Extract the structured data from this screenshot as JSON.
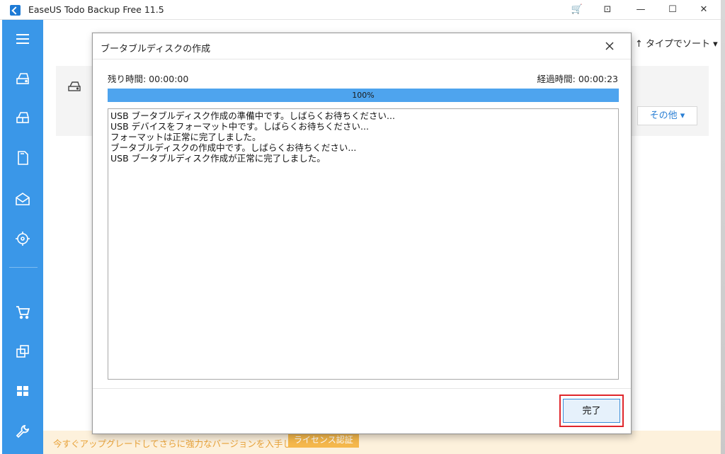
{
  "window": {
    "title": "EaseUS Todo Backup Free 11.5",
    "cart_glyph": "🛒",
    "menu_glyph": "⊡",
    "minimize_glyph": "—",
    "maximize_glyph": "☐",
    "close_glyph": "✕"
  },
  "background": {
    "sort_label": "↑ タイプでソート ▾",
    "other_label": "その他 ▾",
    "license_text": "今すぐアップグレードしてさらに強力なバージョンを入手しましょう。",
    "license_button": "ライセンス認証"
  },
  "sidebar": {
    "icons": [
      "menu-icon",
      "disk-backup-icon",
      "partition-backup-icon",
      "file-backup-icon",
      "mail-backup-icon",
      "smart-backup-icon",
      "cart-icon",
      "clone-icon",
      "windows-icon",
      "tools-icon"
    ]
  },
  "dialog": {
    "title": "ブータブルディスクの作成",
    "remaining": "残り時間: 00:00:00",
    "elapsed": "経過時間: 00:00:23",
    "progress_percent": 100,
    "progress_text": "100%",
    "log_lines": [
      "USB ブータブルディスク作成の準備中です。しばらくお待ちください...",
      "USB デバイスをフォーマット中です。しばらくお待ちください...",
      "フォーマットは正常に完了しました。",
      "ブータブルディスクの作成中です。しばらくお待ちください...",
      "USB ブータブルディスク作成が正常に完了しました。"
    ],
    "done_button": "完了"
  },
  "colors": {
    "sidebar": "#3a97e8",
    "progress": "#4ea4ee",
    "highlight": "#e0262b",
    "license_bg": "#fdf1dc",
    "license_btn": "#f5b84c"
  }
}
